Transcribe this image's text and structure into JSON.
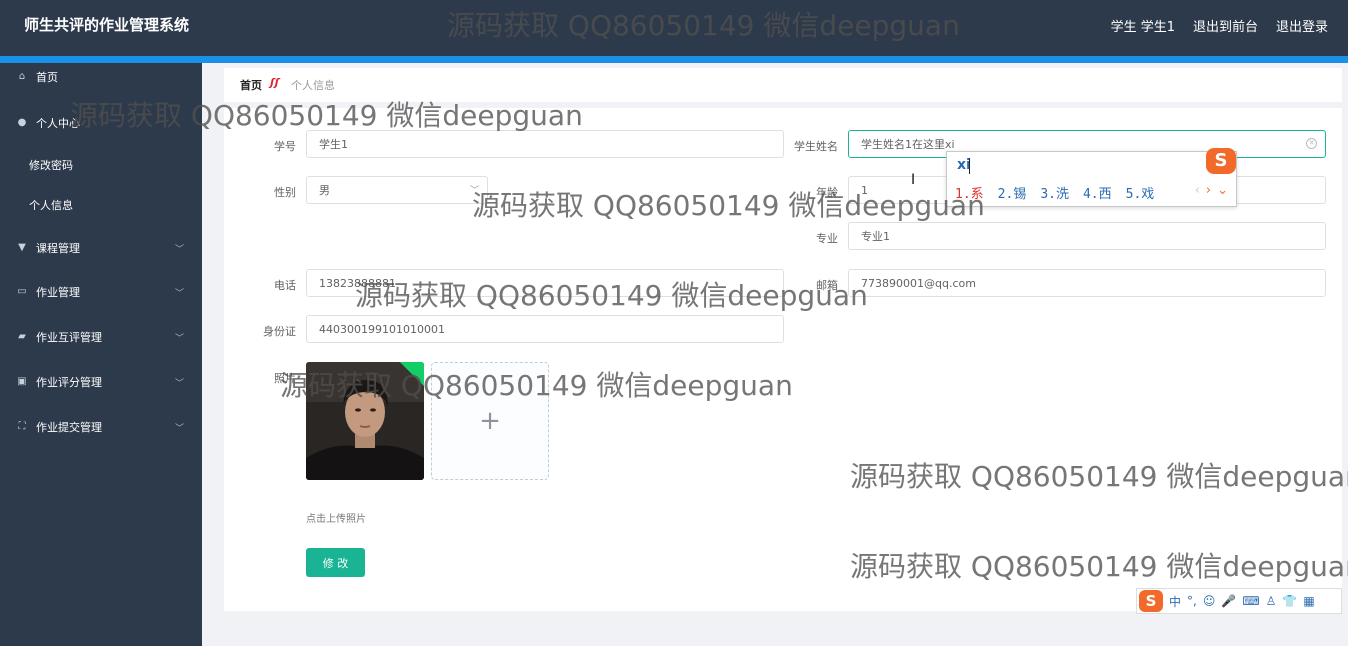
{
  "app": {
    "title": "师生共评的作业管理系统",
    "user": "学生 学生1",
    "back_to_front": "退出到前台",
    "logout": "退出登录"
  },
  "sidebar": {
    "items": [
      {
        "label": "首页",
        "icon": "home-icon"
      },
      {
        "label": "个人中心",
        "icon": "user-icon"
      },
      {
        "label": "修改密码"
      },
      {
        "label": "个人信息"
      },
      {
        "label": "课程管理",
        "icon": "course-icon"
      },
      {
        "label": "作业管理",
        "icon": "chat-icon"
      },
      {
        "label": "作业互评管理",
        "icon": "review-icon"
      },
      {
        "label": "作业评分管理",
        "icon": "score-icon"
      },
      {
        "label": "作业提交管理",
        "icon": "expand-icon"
      }
    ]
  },
  "breadcrumb": {
    "home": "首页",
    "current": "个人信息"
  },
  "form": {
    "student_no_label": "学号",
    "student_no_value": "学生1",
    "student_name_label": "学生姓名",
    "student_name_value": "学生姓名1在这里xi",
    "gender_label": "性别",
    "gender_value": "男",
    "age_label": "年龄",
    "age_value": "1",
    "major_label": "专业",
    "major_value": "专业1",
    "phone_label": "电话",
    "phone_value": "13823888881",
    "email_label": "邮箱",
    "email_value": "773890001@qq.com",
    "id_card_label": "身份证",
    "id_card_value": "440300199101010001",
    "photo_label": "照片",
    "upload_plus": "+",
    "upload_tip": "点击上传照片",
    "submit_label": "修 改"
  },
  "ime": {
    "composition": "xi",
    "candidates": [
      "1.系",
      "2.锡",
      "3.洗",
      "4.西",
      "5.戏"
    ],
    "prev": "‹",
    "next": "›",
    "more": "⌄",
    "logo": "S",
    "toolbar": {
      "logo": "S",
      "lang": "中",
      "punct": "°,",
      "emoji": "☺",
      "voice": "🎤",
      "keyboard": "⌨",
      "people": "♙",
      "skin": "👕",
      "apps": "▦"
    }
  },
  "watermark": "源码获取 QQ86050149 微信deepguan",
  "colors": {
    "header_bg": "#2d3a4b",
    "accent_blue": "#1a90e6",
    "primary_green": "#1ab394"
  }
}
